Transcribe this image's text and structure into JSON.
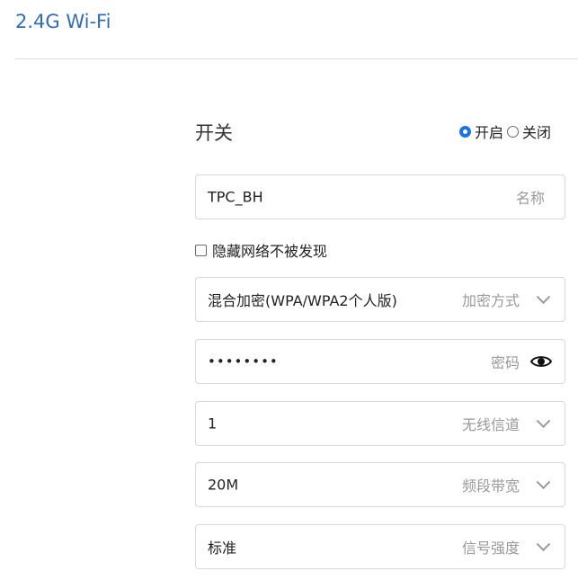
{
  "header": {
    "title": "2.4G Wi-Fi"
  },
  "switch": {
    "label": "开关",
    "options": [
      {
        "label": "开启",
        "checked": true
      },
      {
        "label": "关闭",
        "checked": false
      }
    ]
  },
  "ssid": {
    "value": "TPC_BH",
    "hint": "名称"
  },
  "hide_network": {
    "label": "隐藏网络不被发现",
    "checked": false
  },
  "encryption": {
    "value": "混合加密(WPA/WPA2个人版)",
    "hint": "加密方式"
  },
  "password": {
    "value": "••••••••",
    "hint": "密码",
    "icon": "eye-icon"
  },
  "channel": {
    "value": "1",
    "hint": "无线信道"
  },
  "bandwidth": {
    "value": "20M",
    "hint": "频段带宽"
  },
  "signal": {
    "value": "标准",
    "hint": "信号强度"
  },
  "colors": {
    "accent": "#2f6db5",
    "radio_checked": "#1a73e8",
    "hint": "#9a9a9a",
    "border": "#d9d9d9"
  }
}
